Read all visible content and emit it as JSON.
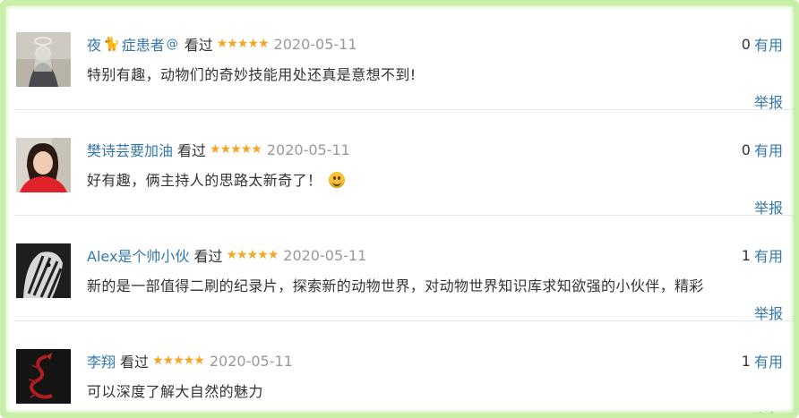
{
  "reviews": [
    {
      "user": "夜",
      "user_suffix": "症患者",
      "badge_pre": "cat-emoji",
      "badge_post": "swirl-emoji",
      "watched": "看过",
      "rating": 5,
      "date": "2020-05-11",
      "comment": "特别有趣，动物们的奇妙技能用处还真是意想不到!",
      "useful_count": "0",
      "useful_label": "有用",
      "report_label": "举报"
    },
    {
      "user": "樊诗芸要加油",
      "watched": "看过",
      "rating": 5,
      "date": "2020-05-11",
      "comment": "好有趣，俩主持人的思路太新奇了！",
      "emoji": "smile-emoji",
      "useful_count": "0",
      "useful_label": "有用",
      "report_label": "举报"
    },
    {
      "user": "Alex是个帅小伙",
      "watched": "看过",
      "rating": 5,
      "date": "2020-05-11",
      "comment": "新的是一部值得二刷的纪录片，探索新的动物世界，对动物世界知识库求知欲强的小伙伴，精彩",
      "useful_count": "1",
      "useful_label": "有用",
      "report_label": "举报"
    },
    {
      "user": "李翔",
      "watched": "看过",
      "rating": 5,
      "date": "2020-05-11",
      "comment": "可以深度了解大自然的魅力",
      "useful_count": "1",
      "useful_label": "有用",
      "report_label": "举报"
    }
  ],
  "colors": {
    "link": "#3377aa",
    "star": "#f6a623",
    "date": "#999999",
    "text": "#333333",
    "frame": "#c8efa8"
  }
}
